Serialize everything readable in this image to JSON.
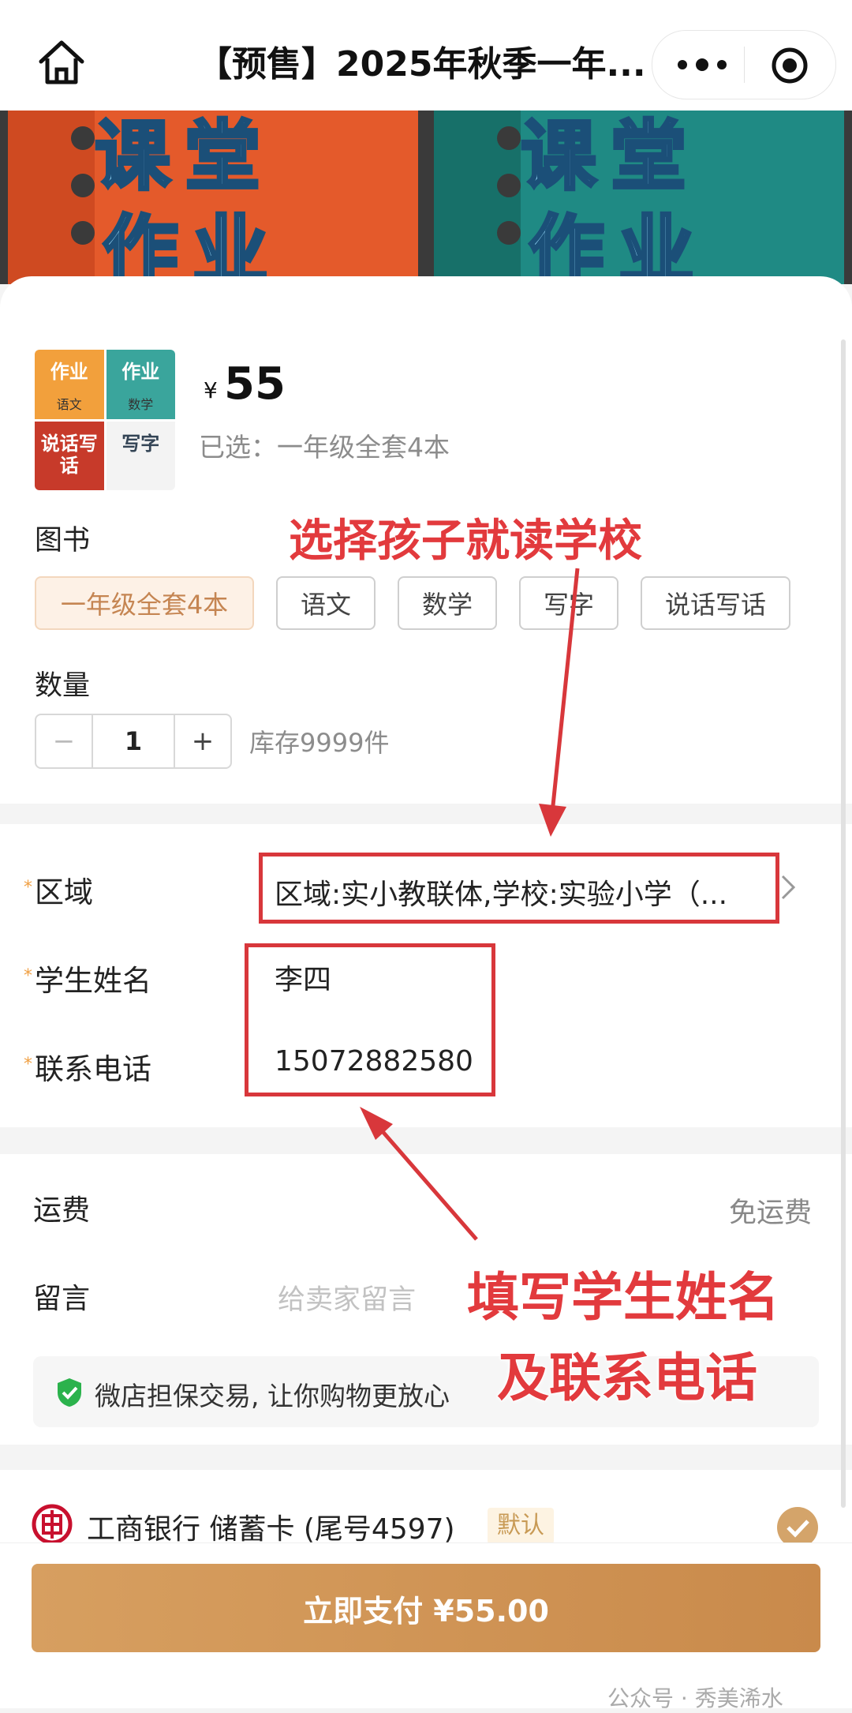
{
  "header": {
    "title": "【预售】2025年秋季一年...",
    "home_icon": "home-icon",
    "more_icon": "more-dots-icon",
    "close_icon": "target-icon"
  },
  "product": {
    "thumb_labels": [
      "作业",
      "作业",
      "说话写话",
      "写字"
    ],
    "thumb_subs": [
      "语文",
      "数学",
      "",
      ""
    ],
    "currency": "¥",
    "price": "55",
    "selected": "已选：一年级全套4本"
  },
  "options": {
    "label": "图书",
    "items": [
      "一年级全套4本",
      "语文",
      "数学",
      "写字",
      "说话写话"
    ],
    "selected_index": 0
  },
  "quantity": {
    "label": "数量",
    "minus": "−",
    "value": "1",
    "plus": "+",
    "stock": "库存9999件"
  },
  "form": {
    "region_label": "区域",
    "region_value": "区域:实小教联体,学校:实验小学（...",
    "name_label": "学生姓名",
    "name_value": "李四",
    "phone_label": "联系电话",
    "phone_value": "15072882580",
    "required_mark": "*"
  },
  "shipping": {
    "label": "运费",
    "value": "免运费",
    "message_label": "留言",
    "message_placeholder": "给卖家留言"
  },
  "guarantee": {
    "text": "微店担保交易, 让你购物更放心"
  },
  "payment": {
    "bank": "工商银行 储蓄卡 (尾号4597)",
    "default_badge": "默认",
    "pay_button": "立即支付 ¥55.00"
  },
  "annotations": {
    "school": "选择孩子就读学校",
    "fill_line1": "填写学生姓名",
    "fill_line2": "及联系电话"
  },
  "watermark": "公众号 · 秀美浠水",
  "colors": {
    "accent": "#c98a4b",
    "annotation": "#d8373b",
    "shield": "#2bb24c"
  }
}
